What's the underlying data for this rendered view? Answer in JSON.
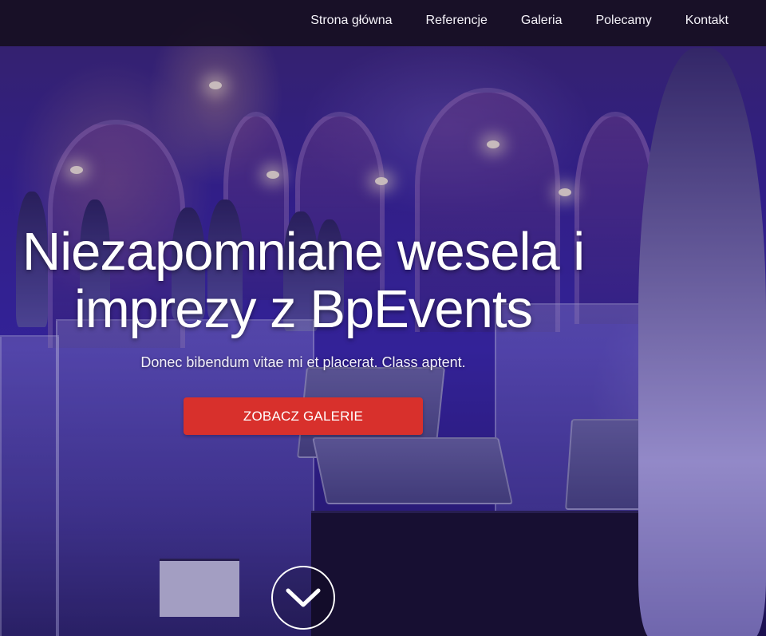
{
  "navbar": {
    "items": [
      {
        "label": "Strona główna"
      },
      {
        "label": "Referencje"
      },
      {
        "label": "Galeria"
      },
      {
        "label": "Polecamy"
      },
      {
        "label": "Kontakt"
      }
    ]
  },
  "hero": {
    "headline_line1": "Niezapomniane wesela i",
    "headline_line2": "imprezy z BpEvents",
    "subtitle": "Donec bibendum vitae mi et placerat. Class aptent.",
    "cta_label": "ZOBACZ GALERIE",
    "scroll_icon": "chevron-down-icon"
  },
  "colors": {
    "cta": "#d8302c",
    "navbar_bg": "#140e1e",
    "text": "#ffffff"
  }
}
